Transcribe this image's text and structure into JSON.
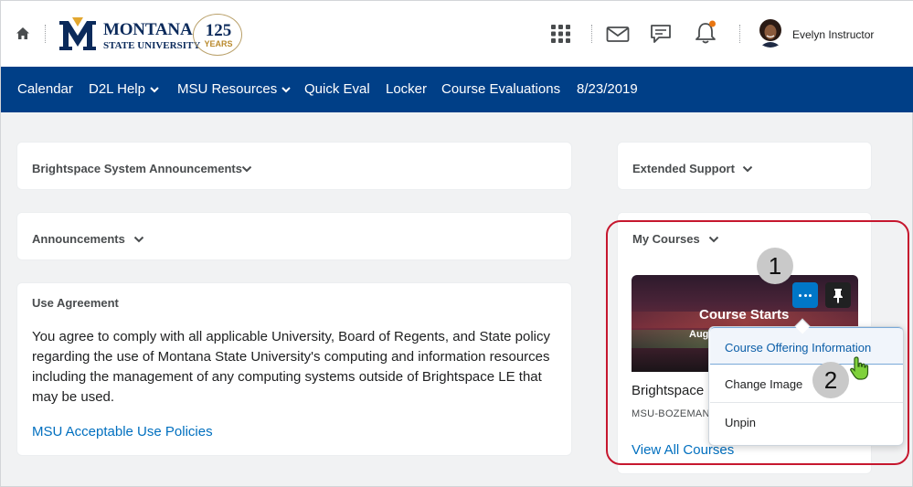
{
  "header": {
    "logo": {
      "line1": "MONTANA",
      "line2": "STATE UNIVERSITY",
      "anniversary_number": "125",
      "anniversary_word": "YEARS"
    },
    "icons": [
      "home-icon",
      "waffle-icon",
      "mail-icon",
      "chat-icon",
      "bell-icon"
    ],
    "user_name": "Evelyn Instructor"
  },
  "nav": {
    "items": [
      {
        "label": "Calendar"
      },
      {
        "label": "D2L Help"
      },
      {
        "label": "MSU Resources"
      },
      {
        "label": "Quick Eval"
      },
      {
        "label": "Locker"
      },
      {
        "label": "Course Evaluations"
      },
      {
        "label": "8/23/2019"
      }
    ]
  },
  "widgets": {
    "system_announcements": {
      "title": "Brightspace System Announcements"
    },
    "announcements": {
      "title": "Announcements"
    },
    "use_agreement": {
      "title": "Use Agreement",
      "body": "You agree to comply with all applicable University, Board of Regents, and State policy regarding the use of Montana State University's computing and information resources including the management of any computing systems outside of Brightspace LE that may be used.",
      "link": "MSU Acceptable Use Policies"
    },
    "extended_support": {
      "title": "Extended Support"
    },
    "my_courses": {
      "title": "My Courses",
      "tile_label": "Course Starts",
      "tile_sub": "Aug",
      "course_name": "Brightspace",
      "course_code": "MSU-BOZEMAN",
      "view_all": "View All Courses"
    }
  },
  "menu": {
    "items": [
      {
        "label": "Course Offering Information"
      },
      {
        "label": "Change Image"
      },
      {
        "label": "Unpin"
      }
    ]
  },
  "annotations": {
    "step1": "1",
    "step2": "2",
    "color": "#c6172e"
  },
  "colors": {
    "navbar": "#003f87",
    "link": "#006fbf",
    "accent_button": "#0077c8"
  }
}
